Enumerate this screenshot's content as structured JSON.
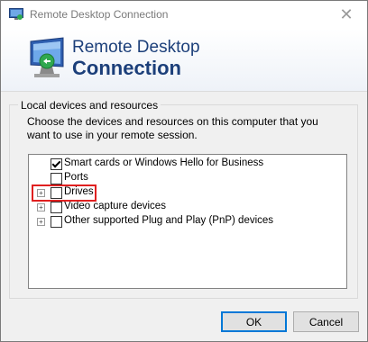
{
  "window": {
    "title": "Remote Desktop Connection",
    "close_symbol": "✕"
  },
  "banner": {
    "line1": "Remote Desktop",
    "line2": "Connection"
  },
  "group": {
    "label": "Local devices and resources",
    "description": "Choose the devices and resources on this computer that you want to use in your remote session."
  },
  "tree": {
    "items": [
      {
        "label": "Smart cards or Windows Hello for Business",
        "checked": true,
        "expandable": false
      },
      {
        "label": "Ports",
        "checked": false,
        "expandable": false
      },
      {
        "label": "Drives",
        "checked": false,
        "expandable": true,
        "highlighted": true
      },
      {
        "label": "Video capture devices",
        "checked": false,
        "expandable": true
      },
      {
        "label": "Other supported Plug and Play (PnP) devices",
        "checked": false,
        "expandable": true
      }
    ]
  },
  "buttons": {
    "ok": "OK",
    "cancel": "Cancel"
  },
  "colors": {
    "banner_text": "#1c3f7a",
    "highlight": "#e02020",
    "ok_border": "#0078d7"
  }
}
